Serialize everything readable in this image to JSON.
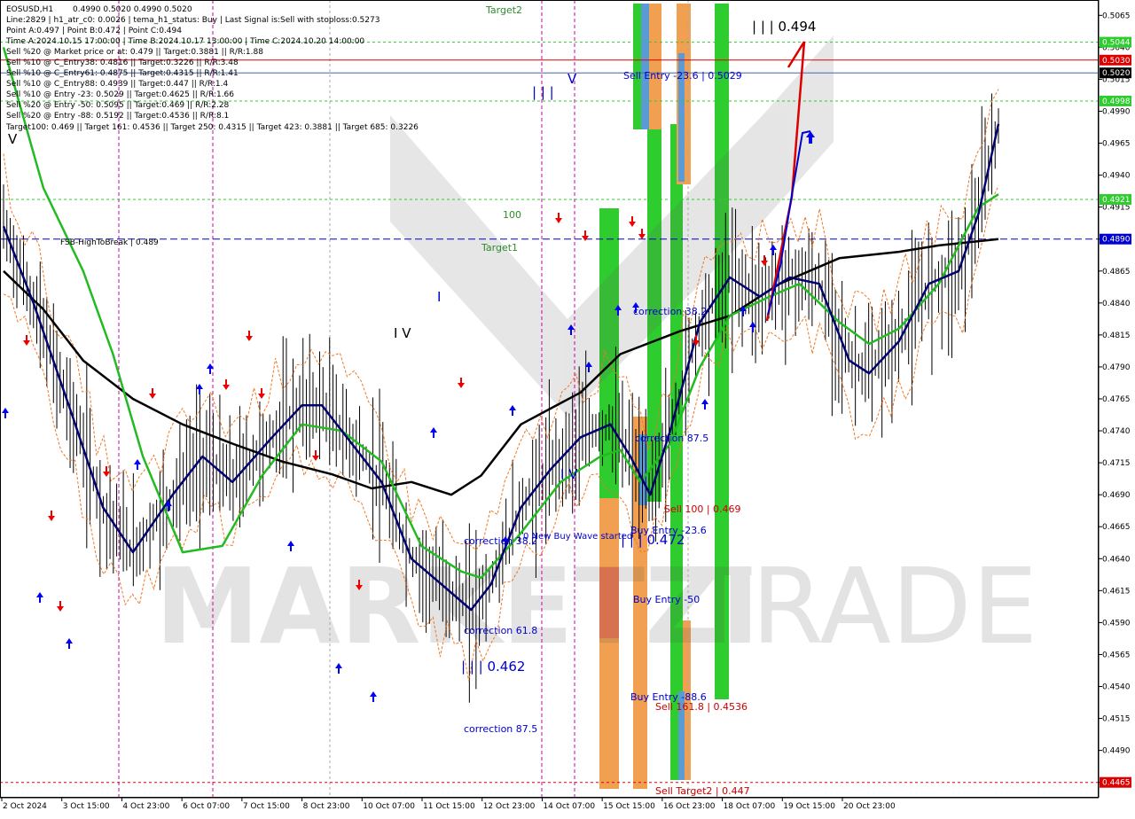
{
  "chart_data": {
    "type": "line",
    "symbol": "EOSUSD,H1",
    "ohlc": "0.4990 0.5020 0.4990 0.5020",
    "info_lines": [
      "Line:2829 | h1_atr_c0: 0.0026 | tema_h1_status: Buy | Last Signal is:Sell with stoploss:0.5273",
      "Point A:0.497 | Point B:0.472 | Point C:0.494",
      "Time A:2024.10.15 17:00:00 | Time B:2024.10.17 13:00:00 | Time C:2024.10.20 14:00:00",
      "Sell %20 @ Market price or at: 0.479 || Target:0.3881 || R/R:1.88",
      "Sell %10 @ C_Entry38: 0.4816 || Target:0.3226 || R/R:3.48",
      "Sell %10 @ C_Entry61: 0.4875 || Target:0.4315 || R/R:1.41",
      "Sell %10 @ C_Entry88: 0.4939 || Target:0.447 || R/R:1.4",
      "Sell %10 @ Entry -23: 0.5029 || Target:0.4625 || R/R:1.66",
      "Sell %20 @ Entry -50: 0.5095 || Target:0.469 || R/R:2.28",
      "Sell %20 @ Entry -88: 0.5192 || Target:0.4536 || R/R:8.1",
      "Target100: 0.469 || Target 161: 0.4536 || Target 250: 0.4315 || Target 423: 0.3881 || Target 685: 0.3226"
    ],
    "price_axis": {
      "range": [
        0.4453,
        0.5077
      ],
      "ticks": [
        "0.5065",
        "0.5040",
        "0.5015",
        "0.4990",
        "0.4965",
        "0.4940",
        "0.4915",
        "0.4890",
        "0.4865",
        "0.4840",
        "0.4815",
        "0.4790",
        "0.4765",
        "0.4740",
        "0.4715",
        "0.4690",
        "0.4665",
        "0.4640",
        "0.4615",
        "0.4590",
        "0.4565",
        "0.4540",
        "0.4515",
        "0.4490",
        "0.4465"
      ]
    },
    "time_axis": {
      "ticks": [
        "2 Oct 2024",
        "3 Oct 15:00",
        "4 Oct 23:00",
        "6 Oct 07:00",
        "7 Oct 15:00",
        "8 Oct 23:00",
        "10 Oct 07:00",
        "11 Oct 15:00",
        "12 Oct 23:00",
        "14 Oct 07:00",
        "15 Oct 15:00",
        "16 Oct 23:00",
        "18 Oct 07:00",
        "19 Oct 15:00",
        "20 Oct 23:00"
      ]
    },
    "price_markers": [
      {
        "price": 0.5044,
        "text": "0.5044",
        "color": "#2ecc2e"
      },
      {
        "price": 0.503,
        "text": "0.5030",
        "color": "#dd0000"
      },
      {
        "price": 0.502,
        "text": "0.5020",
        "color": "#000000"
      },
      {
        "price": 0.4998,
        "text": "0.4998",
        "color": "#2ecc2e"
      },
      {
        "price": 0.4921,
        "text": "0.4921",
        "color": "#2ecc2e"
      },
      {
        "price": 0.489,
        "text": "0.4890",
        "color": "#0000cc"
      },
      {
        "price": 0.4465,
        "text": "0.4465",
        "color": "#dd0000"
      }
    ],
    "hlines": [
      {
        "price": 0.5044,
        "color": "#2ecc2e",
        "style": "dash"
      },
      {
        "price": 0.503,
        "color": "#dd0000",
        "style": "solid"
      },
      {
        "price": 0.502,
        "color": "#4466aa",
        "style": "solid"
      },
      {
        "price": 0.4998,
        "color": "#2ecc2e",
        "style": "dash"
      },
      {
        "price": 0.4921,
        "color": "#2ecc2e",
        "style": "dash"
      },
      {
        "price": 0.489,
        "color": "#0000cc",
        "style": "longdash"
      },
      {
        "price": 0.4465,
        "color": "#dd0000",
        "style": "dash"
      }
    ],
    "annotations": [
      {
        "text": "FSB-HighToBreak | 0.489",
        "color": "black"
      },
      {
        "text": "Target2",
        "color": "green"
      },
      {
        "text": "Target1",
        "color": "green"
      },
      {
        "text": "100",
        "color": "green"
      },
      {
        "text": "Sell Entry -23.6 | 0.5029",
        "color": "blue"
      },
      {
        "text": "| | | 0.494",
        "color": "black"
      },
      {
        "text": "correction 38.2",
        "color": "blue"
      },
      {
        "text": "correction 87.5",
        "color": "blue"
      },
      {
        "text": "Sell 100 | 0.469",
        "color": "red"
      },
      {
        "text": "Buy Entry -23.6",
        "color": "blue"
      },
      {
        "text": "| | | 0.472",
        "color": "blue"
      },
      {
        "text": "Buy Entry -50",
        "color": "blue"
      },
      {
        "text": "Buy Entry -88.6",
        "color": "blue"
      },
      {
        "text": "Sell 161.8 | 0.4536",
        "color": "red"
      },
      {
        "text": "Sell Target2 | 0.447",
        "color": "red"
      },
      {
        "text": "0 New Buy Wave started",
        "color": "blue"
      },
      {
        "text": "correction 38.2",
        "color": "blue"
      },
      {
        "text": "correction 61.8",
        "color": "blue"
      },
      {
        "text": "| | | 0.462",
        "color": "blue"
      },
      {
        "text": "correction 87.5",
        "color": "blue"
      },
      {
        "text": "| | |",
        "color": "blue"
      },
      {
        "text": "V",
        "color": "blue"
      },
      {
        "text": "I",
        "color": "blue"
      },
      {
        "text": "I V",
        "color": "black"
      },
      {
        "text": "I V",
        "color": "blue"
      },
      {
        "text": "V",
        "color": "black"
      }
    ],
    "series": [
      {
        "color": "#000000",
        "points": [
          [
            0.0,
            0.4865
          ],
          [
            0.04,
            0.4835
          ],
          [
            0.08,
            0.4795
          ],
          [
            0.13,
            0.4765
          ],
          [
            0.18,
            0.4745
          ],
          [
            0.23,
            0.473
          ],
          [
            0.28,
            0.4716
          ],
          [
            0.33,
            0.4706
          ],
          [
            0.37,
            0.4695
          ],
          [
            0.41,
            0.47
          ],
          [
            0.45,
            0.469
          ],
          [
            0.48,
            0.4705
          ],
          [
            0.52,
            0.4745
          ],
          [
            0.58,
            0.477
          ],
          [
            0.62,
            0.48
          ],
          [
            0.68,
            0.4818
          ],
          [
            0.73,
            0.483
          ],
          [
            0.78,
            0.4855
          ],
          [
            0.84,
            0.4875
          ],
          [
            0.9,
            0.488
          ],
          [
            0.94,
            0.4885
          ],
          [
            1.0,
            0.489
          ]
        ]
      },
      {
        "color": "#22bb22",
        "points": [
          [
            0.0,
            0.504
          ],
          [
            0.04,
            0.493
          ],
          [
            0.08,
            0.4865
          ],
          [
            0.11,
            0.48
          ],
          [
            0.14,
            0.472
          ],
          [
            0.18,
            0.4645
          ],
          [
            0.22,
            0.465
          ],
          [
            0.26,
            0.4705
          ],
          [
            0.3,
            0.4745
          ],
          [
            0.34,
            0.474
          ],
          [
            0.38,
            0.4716
          ],
          [
            0.42,
            0.465
          ],
          [
            0.46,
            0.463
          ],
          [
            0.48,
            0.4625
          ],
          [
            0.52,
            0.466
          ],
          [
            0.56,
            0.47
          ],
          [
            0.6,
            0.472
          ],
          [
            0.62,
            0.4725
          ],
          [
            0.64,
            0.47
          ],
          [
            0.67,
            0.473
          ],
          [
            0.7,
            0.479
          ],
          [
            0.73,
            0.483
          ],
          [
            0.77,
            0.4845
          ],
          [
            0.8,
            0.4855
          ],
          [
            0.84,
            0.4825
          ],
          [
            0.87,
            0.4808
          ],
          [
            0.9,
            0.482
          ],
          [
            0.94,
            0.4855
          ],
          [
            0.98,
            0.4915
          ],
          [
            1.0,
            0.4925
          ]
        ]
      },
      {
        "color": "#00006e",
        "points": [
          [
            0.0,
            0.49
          ],
          [
            0.03,
            0.484
          ],
          [
            0.07,
            0.475
          ],
          [
            0.1,
            0.468
          ],
          [
            0.13,
            0.4645
          ],
          [
            0.17,
            0.469
          ],
          [
            0.2,
            0.472
          ],
          [
            0.23,
            0.47
          ],
          [
            0.27,
            0.4735
          ],
          [
            0.3,
            0.476
          ],
          [
            0.32,
            0.476
          ],
          [
            0.34,
            0.474
          ],
          [
            0.38,
            0.47
          ],
          [
            0.41,
            0.464
          ],
          [
            0.44,
            0.462
          ],
          [
            0.47,
            0.46
          ],
          [
            0.49,
            0.462
          ],
          [
            0.52,
            0.468
          ],
          [
            0.55,
            0.471
          ],
          [
            0.58,
            0.4735
          ],
          [
            0.61,
            0.4745
          ],
          [
            0.63,
            0.472
          ],
          [
            0.65,
            0.469
          ],
          [
            0.67,
            0.474
          ],
          [
            0.7,
            0.4825
          ],
          [
            0.73,
            0.486
          ],
          [
            0.76,
            0.4845
          ],
          [
            0.79,
            0.486
          ],
          [
            0.82,
            0.4855
          ],
          [
            0.85,
            0.4795
          ],
          [
            0.87,
            0.4785
          ],
          [
            0.9,
            0.481
          ],
          [
            0.93,
            0.4855
          ],
          [
            0.96,
            0.4865
          ],
          [
            0.98,
            0.491
          ],
          [
            1.0,
            0.498
          ]
        ]
      }
    ]
  }
}
